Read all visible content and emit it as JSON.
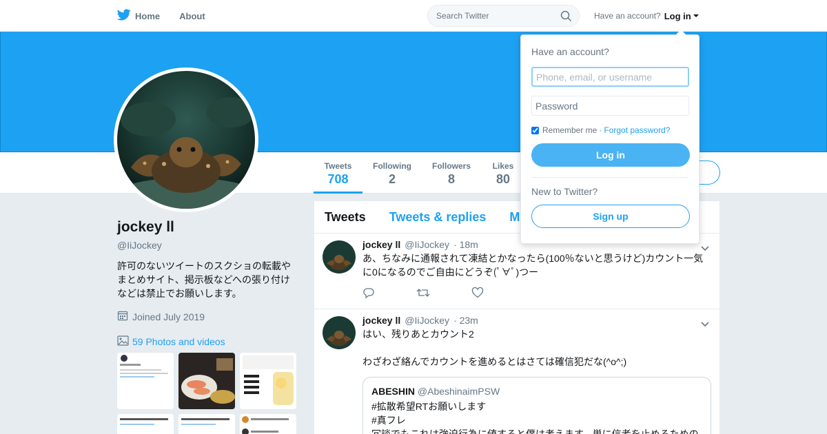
{
  "nav": {
    "home_label": "Home",
    "about_label": "About",
    "search_placeholder": "Search Twitter",
    "account_prompt": "Have an account?",
    "login_label": "Log in"
  },
  "colors": {
    "accent": "#1da1f2",
    "banner": "#1da1f2",
    "background": "#e6ecf0"
  },
  "stats": [
    {
      "label": "Tweets",
      "value": "708"
    },
    {
      "label": "Following",
      "value": "2"
    },
    {
      "label": "Followers",
      "value": "8"
    },
    {
      "label": "Likes",
      "value": "80"
    }
  ],
  "profile": {
    "name": "jockey ll",
    "handle": "@IiJockey",
    "bio": "許可のないツイートのスクショの転載やまとめサイト、掲示板などへの張り付けなどは禁止でお願いします。",
    "joined": "Joined July 2019",
    "photos": "59 Photos and videos"
  },
  "tabs": [
    {
      "label": "Tweets"
    },
    {
      "label": "Tweets & replies"
    },
    {
      "label": "M"
    }
  ],
  "tweets": [
    {
      "name": "jockey ll",
      "handle": "@IiJockey",
      "time": "· 18m",
      "text": "あ、ちなみに通報されて凍結とかなったら(100％ないと思うけど)カウント一気に0になるのでご自由にどうぞ(ﾟ∀ﾟ)つー"
    },
    {
      "name": "jockey ll",
      "handle": "@IiJockey",
      "time": "· 23m",
      "text_1": "はい、残りあとカウント2",
      "text_2": "わざわざ絡んでカウントを進めるとはさては確信犯だな(^o^;)",
      "quote": {
        "name": "ABESHIN",
        "handle": "@AbeshinaimPSW",
        "line_1": "#拡散希望RTお願いします",
        "line_2": "#真フレ",
        "line_3": "冗談でもこれは強迫行為に値すると僕は考えます。単に信者を止めるための"
      }
    }
  ],
  "login_dropdown": {
    "title": "Have an account?",
    "username_placeholder": "Phone, email, or username",
    "password_placeholder": "Password",
    "remember": "Remember me",
    "separator": "·",
    "forgot": "Forgot password?",
    "login_button": "Log in",
    "new_prompt": "New to Twitter?",
    "signup_button": "Sign up"
  }
}
